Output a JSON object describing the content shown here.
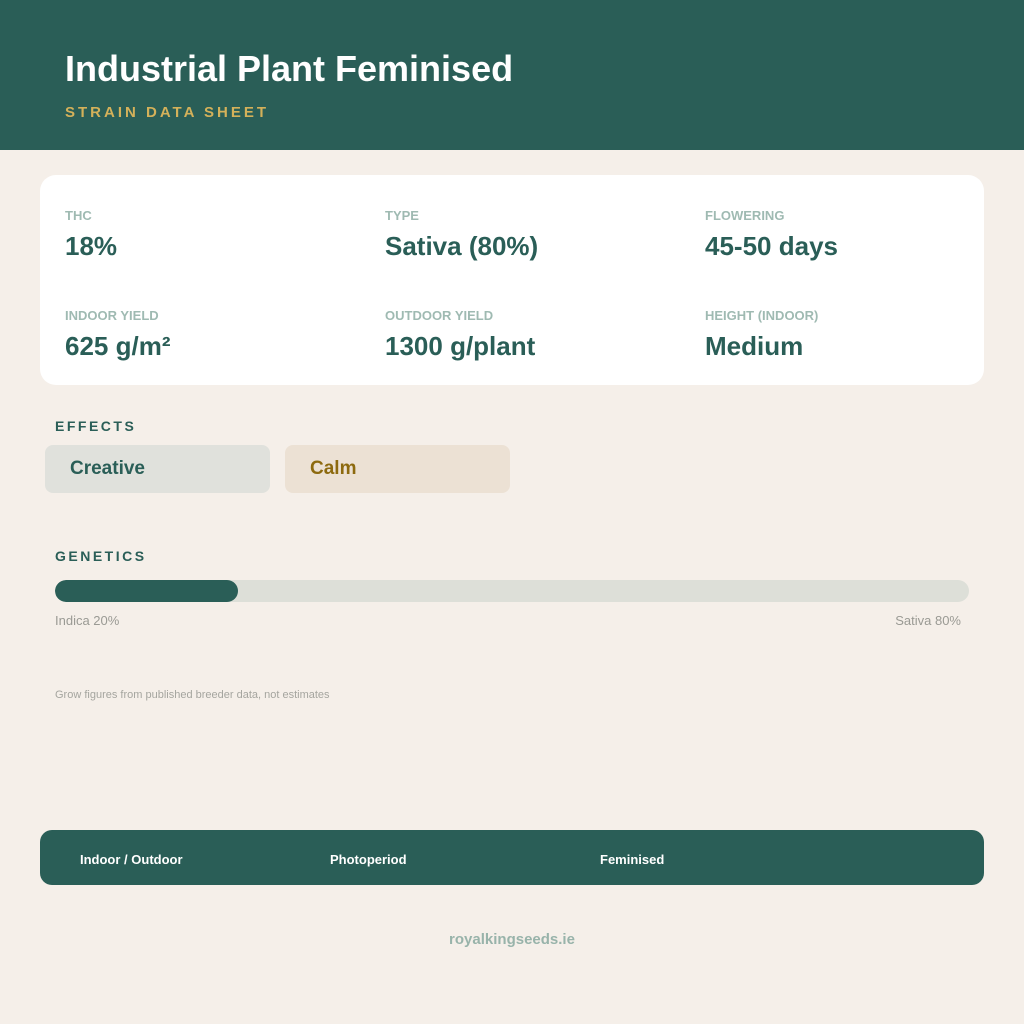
{
  "header": {
    "title": "Industrial Plant Feminised",
    "subtitle": "STRAIN DATA SHEET"
  },
  "stats": [
    {
      "label": "THC",
      "value": "18%"
    },
    {
      "label": "TYPE",
      "value": "Sativa (80%)"
    },
    {
      "label": "FLOWERING",
      "value": "45-50 days"
    },
    {
      "label": "INDOOR YIELD",
      "value": "625 g/m²"
    },
    {
      "label": "OUTDOOR YIELD",
      "value": "1300 g/plant"
    },
    {
      "label": "HEIGHT (INDOOR)",
      "value": "Medium"
    }
  ],
  "effects": {
    "label": "EFFECTS",
    "items": [
      "Creative",
      "Calm"
    ]
  },
  "genetics": {
    "label": "GENETICS",
    "indica_percent": 20,
    "sativa_percent": 80,
    "indica_label": "Indica 20%",
    "sativa_label": "Sativa 80%"
  },
  "note": "Grow figures from published breeder data, not estimates",
  "footer": {
    "items": [
      "Indoor / Outdoor",
      "Photoperiod",
      "Feminised"
    ]
  },
  "website": "royalkingseeds.ie",
  "colors": {
    "brand_green": "#2a5e57",
    "accent_gold": "#d4b15a",
    "background": "#f5efe9"
  }
}
